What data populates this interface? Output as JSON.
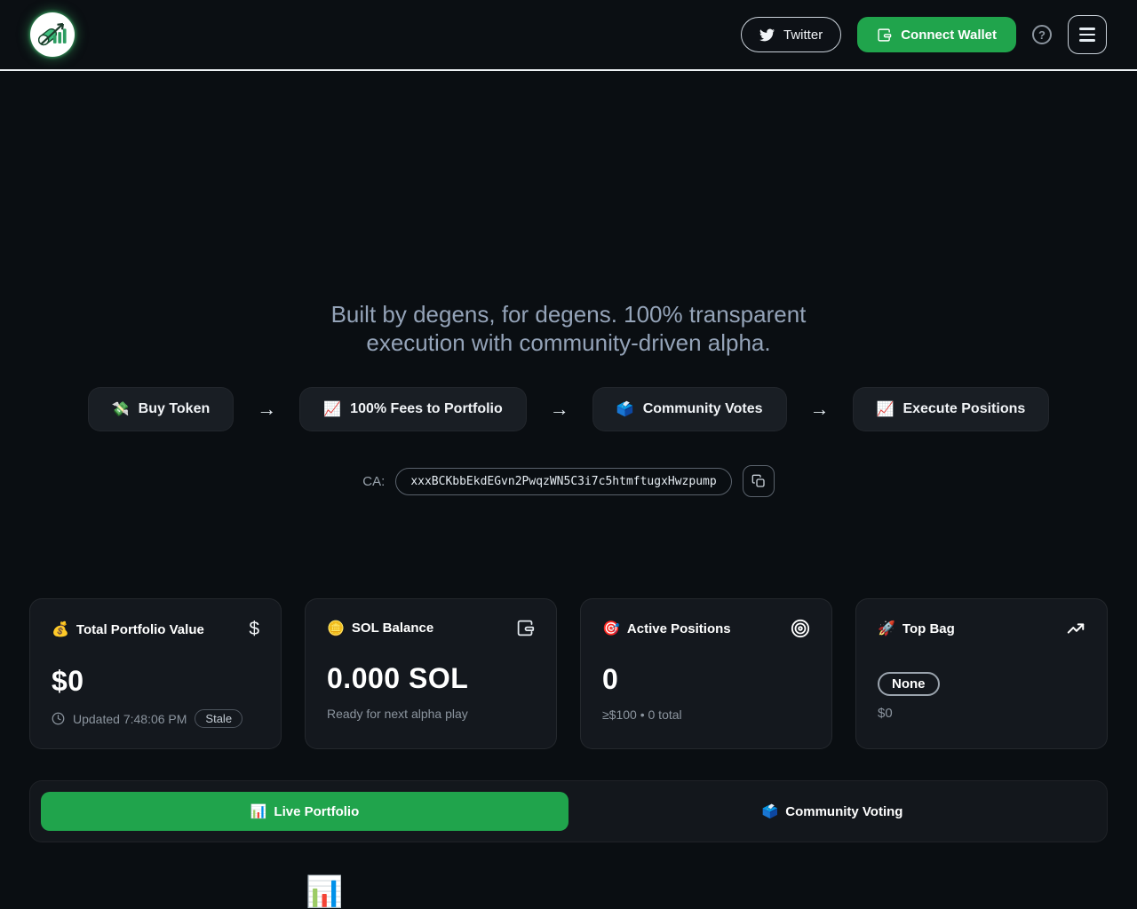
{
  "colors": {
    "accent_green": "#20a44c",
    "page_bg": "#0a0e12",
    "card_bg": "#14181e"
  },
  "header": {
    "twitter_label": "Twitter",
    "connect_wallet_label": "Connect Wallet",
    "help_glyph": "?"
  },
  "hero": {
    "tagline_line1": "Built by degens, for degens. 100% transparent",
    "tagline_line2": "execution with community-driven alpha."
  },
  "flow": {
    "arrow": "→",
    "steps": [
      {
        "emoji": "💸",
        "label": "Buy Token"
      },
      {
        "emoji": "📈",
        "label": "100% Fees to Portfolio"
      },
      {
        "emoji": "🗳️",
        "label": "Community Votes"
      },
      {
        "emoji": "📈",
        "label": "Execute Positions"
      }
    ]
  },
  "contract": {
    "label": "CA:",
    "address": "xxxBCKbbEkdEGvn2PwqzWN5C3i7c5htmftugxHwzpump"
  },
  "stats": {
    "portfolio": {
      "emoji": "💰",
      "title": "Total Portfolio Value",
      "value": "$0",
      "updated": "Updated 7:48:06 PM",
      "badge": "Stale"
    },
    "sol": {
      "emoji": "🪙",
      "title": "SOL Balance",
      "value": "0.000 SOL",
      "subtitle": "Ready for next alpha play"
    },
    "positions": {
      "emoji": "🎯",
      "title": "Active Positions",
      "value": "0",
      "subtitle": "≥$100 • 0 total"
    },
    "topbag": {
      "emoji": "🚀",
      "title": "Top Bag",
      "badge": "None",
      "subtitle": "$0"
    }
  },
  "tabs": {
    "live": {
      "emoji": "📊",
      "label": "Live Portfolio"
    },
    "voting": {
      "emoji": "🗳️",
      "label": "Community Voting"
    }
  },
  "footer": {
    "chart_emoji": "📊"
  }
}
